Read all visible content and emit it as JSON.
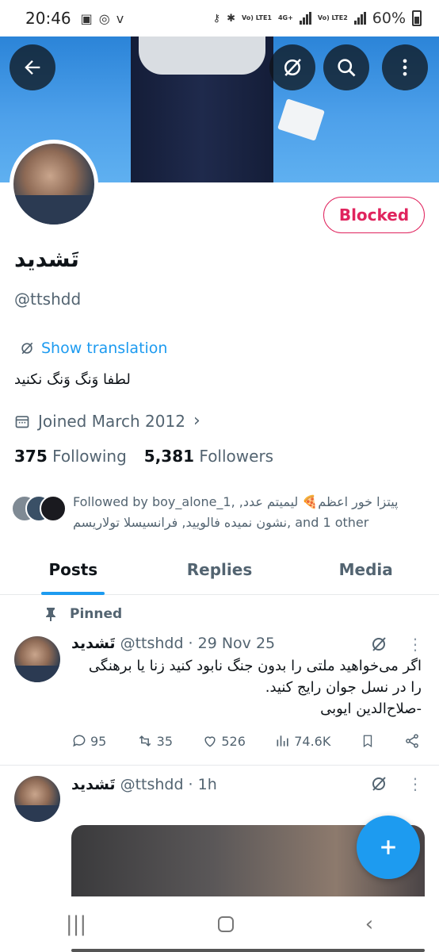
{
  "status_bar": {
    "time": "20:46",
    "battery": "60%",
    "net1": "Vo) LTE1",
    "net2": "4G+",
    "net3": "Vo) LTE2"
  },
  "profile": {
    "display_name": "تَشدید",
    "handle": "@ttshdd",
    "blocked_label": "Blocked",
    "translate_label": "Show translation",
    "bio": "لطفا وَنگ وَنگ نکنید",
    "joined": "Joined March 2012",
    "following_count": "375",
    "following_label": "Following",
    "followers_count": "5,381",
    "followers_label": "Followers",
    "followed_by": "Followed by boy_alone_1, پیتزا خور اعظم🍕 لیمیتم عدد, نشون نمیده فالویید, فرانسیسلا تولاریسم, and 1 other"
  },
  "tabs": [
    {
      "label": "Posts"
    },
    {
      "label": "Replies"
    },
    {
      "label": "Media"
    }
  ],
  "pinned_label": "Pinned",
  "posts": [
    {
      "name": "تَشدید",
      "handle": "@ttshdd",
      "time": "· 29 Nov 25",
      "body_lines": [
        "اگر می‌خواهید ملتی را بدون جنگ نابود کنید زنا یا برهنگی",
        "را در نسل جوان رایج کنید.",
        "-صلاح‌الدین ایوبی"
      ],
      "replies": "95",
      "reposts": "35",
      "likes": "526",
      "views": "74.6K"
    },
    {
      "name": "تَشدید",
      "handle": "@ttshdd",
      "time": "· 1h"
    }
  ],
  "icons": {
    "back": "arrow-left-icon",
    "grok": "grok-icon",
    "search": "search-icon",
    "more": "more-vertical-icon",
    "compose": "plus-icon"
  },
  "colors": {
    "accent": "#1d9bf0",
    "blocked": "#e0245e",
    "muted": "#536471"
  }
}
